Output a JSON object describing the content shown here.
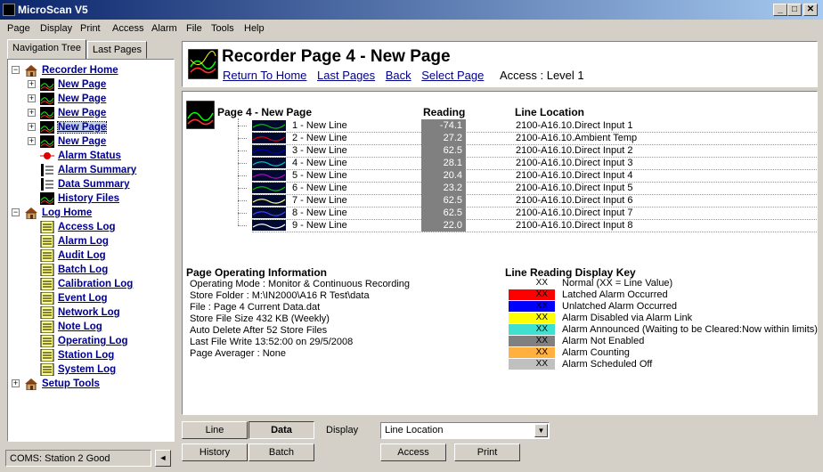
{
  "window": {
    "title": "MicroScan V5",
    "min": "_",
    "max": "□",
    "close": "✕"
  },
  "menu": [
    "Page",
    "Display",
    "Print",
    "Access",
    "Alarm",
    "File",
    "Tools",
    "Help"
  ],
  "nav": {
    "tabs": [
      "Navigation Tree",
      "Last Pages"
    ],
    "tree": [
      {
        "label": "Recorder Home",
        "icon": "home-icon"
      },
      {
        "label": "New Page",
        "icon": "recorder-page-icon"
      },
      {
        "label": "New Page",
        "icon": "recorder-page-icon"
      },
      {
        "label": "New Page",
        "icon": "recorder-page-icon"
      },
      {
        "label": "New Page",
        "icon": "recorder-page-icon"
      },
      {
        "label": "New Page",
        "icon": "recorder-page-icon"
      },
      {
        "label": "Alarm Status",
        "icon": "alarm-status-icon"
      },
      {
        "label": "Alarm Summary",
        "icon": "summary-icon"
      },
      {
        "label": "Data Summary",
        "icon": "summary-icon"
      },
      {
        "label": "History Files",
        "icon": "recorder-page-icon"
      },
      {
        "label": "Log Home",
        "icon": "home-icon"
      },
      {
        "label": "Access Log",
        "icon": "log-icon"
      },
      {
        "label": "Alarm Log",
        "icon": "log-icon"
      },
      {
        "label": "Audit Log",
        "icon": "log-icon"
      },
      {
        "label": "Batch Log",
        "icon": "log-icon"
      },
      {
        "label": "Calibration Log",
        "icon": "log-icon"
      },
      {
        "label": "Event Log",
        "icon": "log-icon"
      },
      {
        "label": "Network Log",
        "icon": "log-icon"
      },
      {
        "label": "Note Log",
        "icon": "log-icon"
      },
      {
        "label": "Operating Log",
        "icon": "log-icon"
      },
      {
        "label": "Station Log",
        "icon": "log-icon"
      },
      {
        "label": "System Log",
        "icon": "log-icon"
      },
      {
        "label": "Setup Tools",
        "icon": "home-icon"
      }
    ],
    "selected_index": 4
  },
  "status": {
    "text": "COMS: Station 2 Good",
    "arrow": "◄"
  },
  "header": {
    "title": "Recorder Page 4 - New Page",
    "links": [
      "Return To Home",
      "Last Pages",
      "Back",
      "Select Page"
    ],
    "access": "Access :  Level 1"
  },
  "table": {
    "page_label": "Page 4 - New Page",
    "col_reading": "Reading",
    "col_location": "Line Location",
    "rows": [
      {
        "name": "1 - New Line",
        "reading": "-74.1",
        "location": "2100-A16.10.Direct Input 1",
        "color": "#00c000"
      },
      {
        "name": "2 - New Line",
        "reading": "27.2",
        "location": "2100-A16.10.Ambient Temp",
        "color": "#e00000"
      },
      {
        "name": "3 - New Line",
        "reading": "62.5",
        "location": "2100-A16.10.Direct Input 2",
        "color": "#0000c0"
      },
      {
        "name": "4 - New Line",
        "reading": "28.1",
        "location": "2100-A16.10.Direct Input 3",
        "color": "#00c0c0"
      },
      {
        "name": "5 - New Line",
        "reading": "20.4",
        "location": "2100-A16.10.Direct Input 4",
        "color": "#c000c0"
      },
      {
        "name": "6 - New Line",
        "reading": "23.2",
        "location": "2100-A16.10.Direct Input 5",
        "color": "#00c000"
      },
      {
        "name": "7 - New Line",
        "reading": "62.5",
        "location": "2100-A16.10.Direct Input 6",
        "color": "#ffff80"
      },
      {
        "name": "8 - New Line",
        "reading": "62.5",
        "location": "2100-A16.10.Direct Input 7",
        "color": "#4040ff"
      },
      {
        "name": "9 - New Line",
        "reading": "22.0",
        "location": "2100-A16.10.Direct Input 8",
        "color": "#ffffff"
      }
    ]
  },
  "info": {
    "title": "Page Operating Information",
    "lines": [
      "Operating Mode : Monitor & Continuous Recording",
      "Store Folder : M:\\IN2000\\A16 R Test\\data",
      "File : Page 4 Current Data.dat",
      "Store File Size 432 KB (Weekly)",
      "Auto Delete After 52 Store Files",
      "Last File Write 13:52:00 on 29/5/2008",
      "Page Averager : None"
    ]
  },
  "key": {
    "title": "Line Reading Display Key",
    "items": [
      {
        "swatch": "XX",
        "label": "Normal (XX = Line Value)",
        "color": "#ffffff"
      },
      {
        "swatch": "XX",
        "label": "Latched Alarm Occurred",
        "color": "#ff0000"
      },
      {
        "swatch": "XX",
        "label": "Unlatched Alarm Occurred",
        "color": "#0000ff"
      },
      {
        "swatch": "XX",
        "label": "Alarm Disabled via Alarm Link",
        "color": "#ffff00"
      },
      {
        "swatch": "XX",
        "label": "Alarm Announced (Waiting to be Cleared:Now within limits)",
        "color": "#40e0d0"
      },
      {
        "swatch": "XX",
        "label": "Alarm Not Enabled",
        "color": "#808080"
      },
      {
        "swatch": "XX",
        "label": "Alarm Counting",
        "color": "#ffb040"
      },
      {
        "swatch": "XX",
        "label": "Alarm Scheduled Off",
        "color": "#c0c0c0"
      }
    ]
  },
  "buttons": {
    "line": "Line",
    "data": "Data",
    "history": "History",
    "batch": "Batch",
    "display_label": "Display",
    "display_value": "Line Location",
    "access": "Access",
    "print": "Print",
    "dropdown": "▼"
  }
}
